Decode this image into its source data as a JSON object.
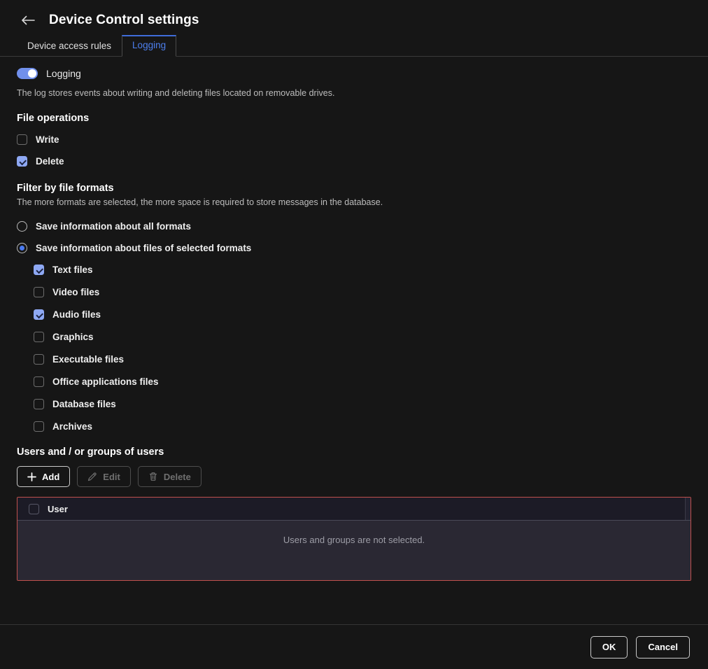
{
  "header": {
    "back_icon": "arrow-left-icon",
    "title": "Device Control settings",
    "tabs": [
      {
        "label": "Device access rules",
        "active": false
      },
      {
        "label": "Logging",
        "active": true
      }
    ]
  },
  "logging": {
    "toggle_label": "Logging",
    "toggle_on": true,
    "description": "The log stores events about writing and deleting files located on removable drives."
  },
  "file_operations": {
    "title": "File operations",
    "items": [
      {
        "label": "Write",
        "checked": false
      },
      {
        "label": "Delete",
        "checked": true
      }
    ]
  },
  "filter_formats": {
    "title": "Filter by file formats",
    "description": "The more formats are selected, the more space is required to store messages in the database.",
    "radios": [
      {
        "label": "Save information about all formats",
        "selected": false
      },
      {
        "label": "Save information about files of selected formats",
        "selected": true
      }
    ],
    "formats": [
      {
        "label": "Text files",
        "checked": true
      },
      {
        "label": "Video files",
        "checked": false
      },
      {
        "label": "Audio files",
        "checked": true
      },
      {
        "label": "Graphics",
        "checked": false
      },
      {
        "label": "Executable files",
        "checked": false
      },
      {
        "label": "Office applications files",
        "checked": false
      },
      {
        "label": "Database files",
        "checked": false
      },
      {
        "label": "Archives",
        "checked": false
      }
    ]
  },
  "users_section": {
    "title": "Users and / or groups of users",
    "buttons": [
      {
        "label": "Add",
        "icon": "plus-icon",
        "disabled": false
      },
      {
        "label": "Edit",
        "icon": "pencil-icon",
        "disabled": true
      },
      {
        "label": "Delete",
        "icon": "trash-icon",
        "disabled": true
      }
    ],
    "table": {
      "header_checkbox_checked": false,
      "column_header": "User",
      "empty_message": "Users and groups are not selected.",
      "error_border_color": "#c0504d"
    }
  },
  "footer": {
    "ok_label": "OK",
    "cancel_label": "Cancel"
  },
  "colors": {
    "background": "#161616",
    "accent_blue": "#4d7fee",
    "toggle_blue": "#7190ec",
    "checkbox_blue": "#8ea8f3",
    "radio_blue": "#4a7af0",
    "error_red": "#c0504d",
    "table_body": "#2a2833",
    "table_header": "#1c1b26"
  }
}
